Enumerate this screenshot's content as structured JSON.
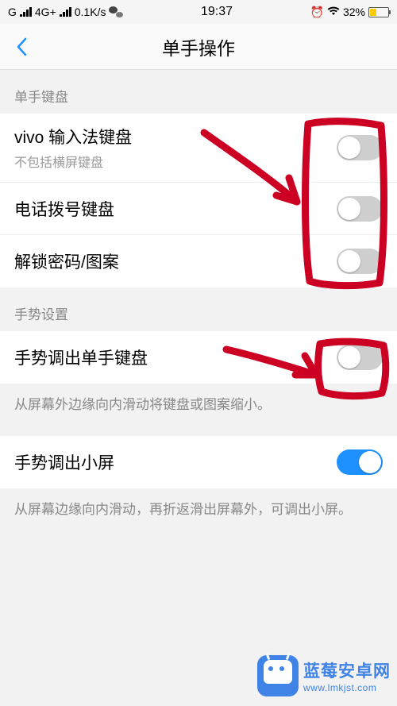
{
  "status": {
    "carrier_prefix": "G",
    "network": "4G+",
    "speed": "0.1K/s",
    "time": "19:37",
    "battery_pct": "32%"
  },
  "header": {
    "title": "单手操作"
  },
  "section1": {
    "header": "单手键盘",
    "row1": {
      "title": "vivo 输入法键盘",
      "sub": "不包括横屏键盘",
      "on": false
    },
    "row2": {
      "title": "电话拨号键盘",
      "on": false
    },
    "row3": {
      "title": "解锁密码/图案",
      "on": false
    }
  },
  "section2": {
    "header": "手势设置",
    "row1": {
      "title": "手势调出单手键盘",
      "on": false
    },
    "hint1": "从屏幕外边缘向内滑动将键盘或图案缩小。",
    "row2": {
      "title": "手势调出小屏",
      "on": true
    },
    "hint2": "从屏幕边缘向内滑动，再折返滑出屏幕外，可调出小屏。"
  },
  "watermark": {
    "text": "蓝莓安卓网",
    "url": "www.lmkjst.com"
  },
  "annotation_color": "#cc0022"
}
